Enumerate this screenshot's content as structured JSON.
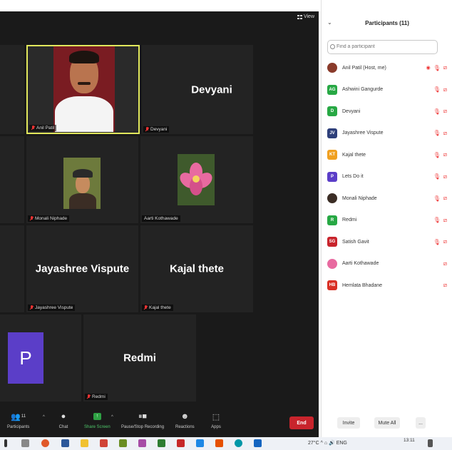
{
  "window": {
    "minimize": "–",
    "restore": "☐",
    "close": "X"
  },
  "meeting": {
    "view_label": "View",
    "tiles": [
      {
        "id": "anil",
        "display": "",
        "label": "Anil Patil",
        "has_video": true
      },
      {
        "id": "devyani",
        "display": "Devyani",
        "label": "Devyani"
      },
      {
        "id": "monali",
        "display": "",
        "label": "Monali Niphade"
      },
      {
        "id": "aarti",
        "display": "",
        "label": "Aarti Kothawade"
      },
      {
        "id": "jayashree",
        "display": "Jayashree Vispute",
        "label": "Jayashree Vispute"
      },
      {
        "id": "kajal",
        "display": "Kajal thete",
        "label": "Kajal thete"
      },
      {
        "id": "p",
        "display": "P",
        "label": ""
      },
      {
        "id": "redmi",
        "display": "Redmi",
        "label": "Redmi"
      }
    ]
  },
  "toolbar": {
    "participants_label": "Participants",
    "participants_count": "11",
    "chat_label": "Chat",
    "share_label": "Share Screen",
    "record_label": "Pause/Stop Recording",
    "reactions_label": "Reactions",
    "apps_label": "Apps",
    "end_label": "End",
    "share_color": "#2ea043",
    "end_color": "#c8242c"
  },
  "panel": {
    "title": "Participants (11)",
    "search_placeholder": "Find a participant",
    "invite_label": "Invite",
    "mute_all_label": "Mute All",
    "more_label": "...",
    "participants": [
      {
        "name": "Anil Patil (Host, me)",
        "initials": "",
        "color": "#8a3b2b",
        "photo": true,
        "rec": true,
        "muted": true,
        "video_off": true
      },
      {
        "name": "Ashwini Gangurde",
        "initials": "AG",
        "color": "#27a844",
        "muted": true,
        "video_off": true
      },
      {
        "name": "Devyani",
        "initials": "D",
        "color": "#27a844",
        "muted": true,
        "video_off": true
      },
      {
        "name": "Jayashree Vispute",
        "initials": "JV",
        "color": "#2e3f7a",
        "muted": true,
        "video_off": true
      },
      {
        "name": "Kajal thete",
        "initials": "KT",
        "color": "#f0a020",
        "muted": true,
        "video_off": true
      },
      {
        "name": "Lets Do it",
        "initials": "P",
        "color": "#5b3ec8",
        "muted": true,
        "video_off": true
      },
      {
        "name": "Monali Niphade",
        "initials": "",
        "color": "#3b2d25",
        "photo": true,
        "muted": true,
        "video_off": true
      },
      {
        "name": "Redmi",
        "initials": "R",
        "color": "#27a844",
        "muted": true,
        "video_off": true
      },
      {
        "name": "Satish Gavit",
        "initials": "SG",
        "color": "#c8242c",
        "muted": true,
        "video_off": true
      },
      {
        "name": "Aarti Kothawade",
        "initials": "",
        "color": "#e86aa0",
        "photo": true,
        "muted": false,
        "video_off": true
      },
      {
        "name": "Hemlata Bhadane",
        "initials": "HB",
        "color": "#d93025",
        "muted": false,
        "video_off": true
      }
    ]
  },
  "taskbar": {
    "weather": "27°C",
    "language": "ENG",
    "time": "13:11"
  }
}
